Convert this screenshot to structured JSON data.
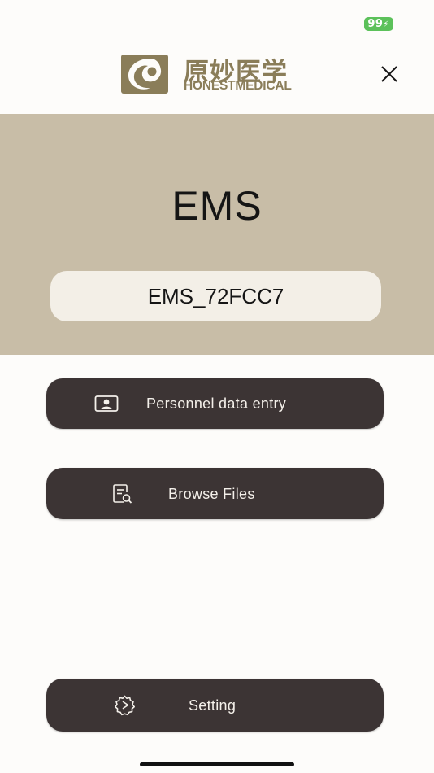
{
  "status_bar": {
    "battery_level": "99",
    "battery_color": "#5cc15a"
  },
  "header": {
    "logo_text_cn": "原妙医学",
    "logo_text_en": "HONESTMEDICAL",
    "brand_color": "#8a7d59",
    "close_icon": "close-icon"
  },
  "hero": {
    "title": "EMS",
    "device_name": "EMS_72FCC7",
    "background_color": "#c8bda7"
  },
  "actions": {
    "personnel_label": "Personnel data entry",
    "personnel_icon": "id-card-icon",
    "browse_label": "Browse Files",
    "browse_icon": "file-search-icon",
    "setting_label": "Setting",
    "setting_icon": "gear-icon",
    "button_color": "#3c3434"
  }
}
